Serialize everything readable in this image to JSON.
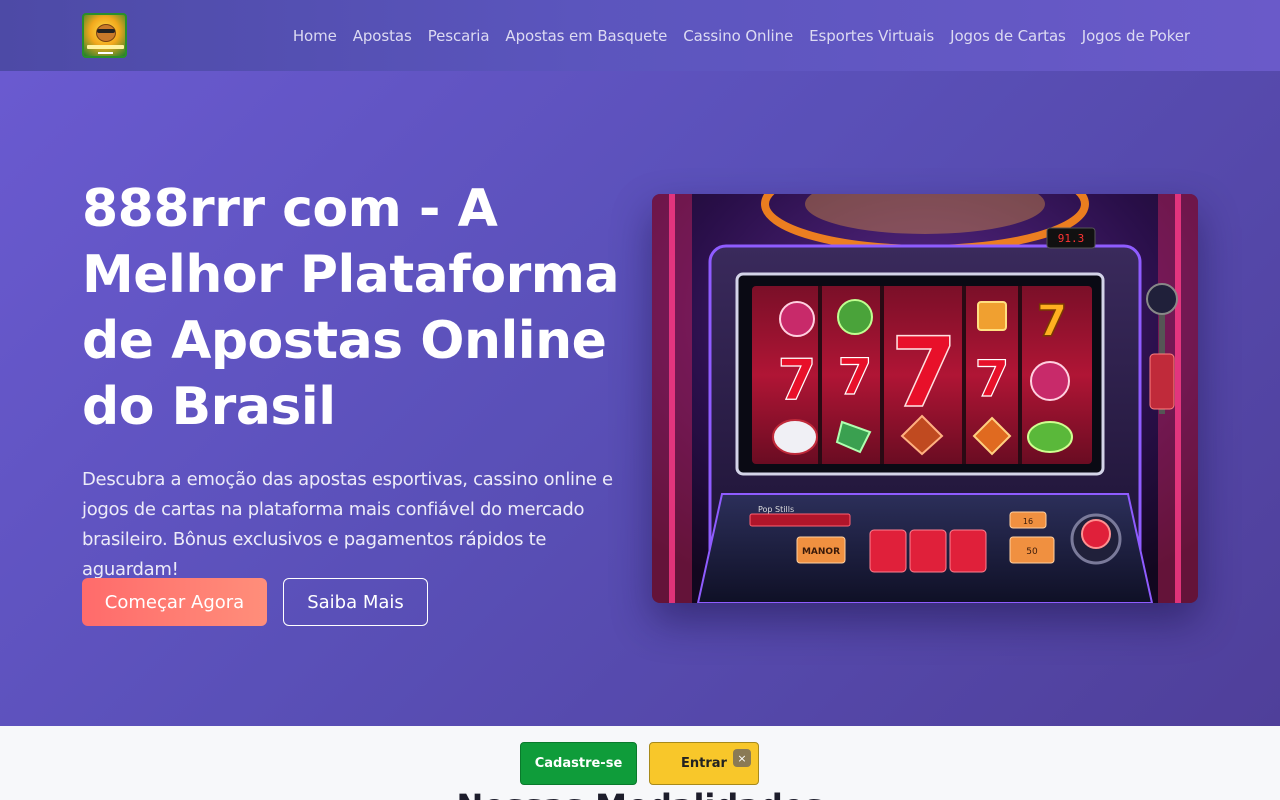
{
  "nav": {
    "items": [
      {
        "label": "Home"
      },
      {
        "label": "Apostas"
      },
      {
        "label": "Pescaria"
      },
      {
        "label": "Apostas em Basquete"
      },
      {
        "label": "Cassino Online"
      },
      {
        "label": "Esportes Virtuais"
      },
      {
        "label": "Jogos de Cartas"
      },
      {
        "label": "Jogos de Poker"
      }
    ]
  },
  "hero": {
    "title": "888rrr com - A Melhor Plataforma de Apostas Online do Brasil",
    "description": "Descubra a emoção das apostas esportivas, cassino online e jogos de cartas na plataforma mais confiável do mercado brasileiro. Bônus exclusivos e pagamentos rápidos te aguardam!",
    "primary_button": "Começar Agora",
    "secondary_button": "Saiba Mais",
    "slot": {
      "display": "91.3",
      "panel_label": "Pop Stills",
      "button_left": "MANOR",
      "button_small_top": "16",
      "button_small_bottom": "50"
    }
  },
  "section": {
    "heading": "Nossas Modalidades"
  },
  "floating": {
    "register": "Cadastre-se",
    "login": "Entrar",
    "close": "×"
  },
  "colors": {
    "hero_gradient_start": "#6a5ad0",
    "hero_gradient_end": "#4f3f9a",
    "primary_button": "#ff7a72",
    "register_button": "#0f9c3a",
    "login_button": "#f8c72a"
  }
}
